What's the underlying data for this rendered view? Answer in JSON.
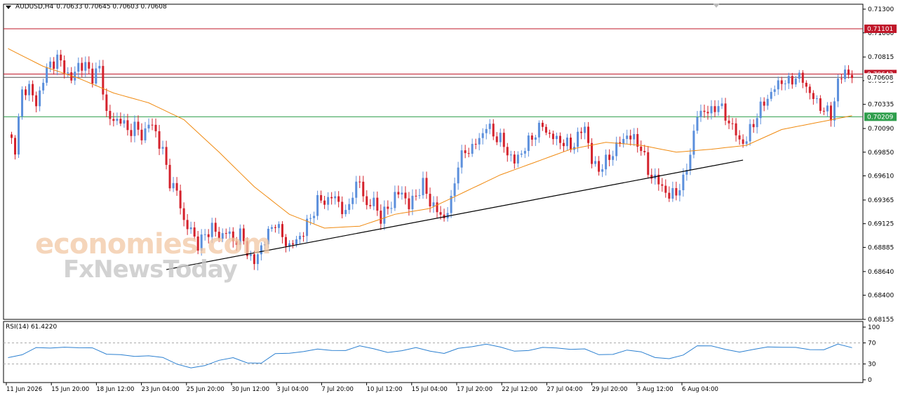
{
  "header": {
    "symbol": "AUDUSD,H4",
    "ohlc": "0.70633 0.70645 0.70603 0.70608"
  },
  "rsi_header": "RSI(14) 61.4220",
  "watermark": {
    "line1": "economies.com",
    "line2": "FxNewsToday"
  },
  "colors": {
    "bull": "#5b8fdc",
    "bear": "#d4222c",
    "ma": "#f08a10",
    "resistance": "#c0182a",
    "support": "#2e9e4c",
    "trendline": "#000000",
    "rsi": "#2a7fd0"
  },
  "chart_data": [
    {
      "type": "candlestick",
      "title": "AUDUSD,H4",
      "x_ticks": [
        "11 Jun 2026",
        "15 Jun 20:00",
        "18 Jun 12:00",
        "23 Jun 04:00",
        "25 Jun 20:00",
        "30 Jun 12:00",
        "3 Jul 04:00",
        "7 Jul 20:00",
        "10 Jul 12:00",
        "15 Jul 04:00",
        "17 Jul 20:00",
        "22 Jul 12:00",
        "27 Jul 04:00",
        "29 Jul 20:00",
        "3 Aug 12:00",
        "6 Aug 04:00"
      ],
      "y_ticks": [
        0.713,
        0.7106,
        0.70815,
        0.70575,
        0.70335,
        0.7009,
        0.6985,
        0.6961,
        0.69365,
        0.69125,
        0.68885,
        0.6864,
        0.684,
        0.68155
      ],
      "ylim": [
        0.68155,
        0.7135
      ],
      "price_labels": [
        {
          "text": "0.71101",
          "value": 0.71101,
          "role": "resistance"
        },
        {
          "text": "0.70642",
          "value": 0.70642,
          "role": "current"
        },
        {
          "text": "0.70608",
          "value": 0.70608,
          "role": "current-close"
        },
        {
          "text": "0.70209",
          "value": 0.70209,
          "role": "support"
        }
      ],
      "horizontal_lines": [
        {
          "value": 0.71101,
          "style": "resistance"
        },
        {
          "value": 0.70642,
          "style": "resistance"
        },
        {
          "value": 0.70608,
          "style": "current"
        },
        {
          "value": 0.70209,
          "style": "support"
        }
      ],
      "trendline": {
        "from": {
          "bar": 45,
          "price": 0.6866
        },
        "to": {
          "bar": 209,
          "price": 0.6977
        }
      },
      "close_path": [
        [
          0,
          0.7003
        ],
        [
          2,
          0.699
        ],
        [
          4,
          0.7045
        ],
        [
          6,
          0.7052
        ],
        [
          8,
          0.7032
        ],
        [
          10,
          0.706
        ],
        [
          12,
          0.7074
        ],
        [
          14,
          0.708
        ],
        [
          16,
          0.707
        ],
        [
          18,
          0.7058
        ],
        [
          20,
          0.7074
        ],
        [
          22,
          0.7072
        ],
        [
          24,
          0.7062
        ],
        [
          26,
          0.707
        ],
        [
          28,
          0.7025
        ],
        [
          30,
          0.7015
        ],
        [
          32,
          0.702
        ],
        [
          34,
          0.7005
        ],
        [
          36,
          0.7012
        ],
        [
          38,
          0.7
        ],
        [
          40,
          0.7015
        ],
        [
          42,
          0.7005
        ],
        [
          44,
          0.6985
        ],
        [
          46,
          0.6955
        ],
        [
          48,
          0.6945
        ],
        [
          50,
          0.6915
        ],
        [
          52,
          0.6905
        ],
        [
          54,
          0.6892
        ],
        [
          56,
          0.69
        ],
        [
          58,
          0.691
        ],
        [
          60,
          0.6898
        ],
        [
          62,
          0.6906
        ],
        [
          64,
          0.6894
        ],
        [
          66,
          0.6902
        ],
        [
          68,
          0.6885
        ],
        [
          70,
          0.6872
        ],
        [
          72,
          0.689
        ],
        [
          74,
          0.6902
        ],
        [
          76,
          0.6915
        ],
        [
          78,
          0.6898
        ],
        [
          80,
          0.689
        ],
        [
          82,
          0.6895
        ],
        [
          84,
          0.6905
        ],
        [
          86,
          0.6918
        ],
        [
          88,
          0.6936
        ],
        [
          90,
          0.6935
        ],
        [
          92,
          0.694
        ],
        [
          94,
          0.6935
        ],
        [
          96,
          0.692
        ],
        [
          98,
          0.6945
        ],
        [
          100,
          0.6955
        ],
        [
          102,
          0.693
        ],
        [
          104,
          0.6935
        ],
        [
          106,
          0.6918
        ],
        [
          108,
          0.6928
        ],
        [
          110,
          0.694
        ],
        [
          112,
          0.6945
        ],
        [
          114,
          0.693
        ],
        [
          116,
          0.6942
        ],
        [
          118,
          0.6952
        ],
        [
          120,
          0.6935
        ],
        [
          122,
          0.6925
        ],
        [
          124,
          0.6918
        ],
        [
          126,
          0.6935
        ],
        [
          128,
          0.6975
        ],
        [
          130,
          0.6985
        ],
        [
          132,
          0.699
        ],
        [
          134,
          0.6998
        ],
        [
          136,
          0.7012
        ],
        [
          138,
          0.7003
        ],
        [
          140,
          0.6998
        ],
        [
          142,
          0.6985
        ],
        [
          144,
          0.6975
        ],
        [
          146,
          0.6985
        ],
        [
          148,
          0.6995
        ],
        [
          150,
          0.7005
        ],
        [
          152,
          0.7012
        ],
        [
          154,
          0.7002
        ],
        [
          156,
          0.6998
        ],
        [
          158,
          0.6995
        ],
        [
          160,
          0.699
        ],
        [
          162,
          0.7
        ],
        [
          164,
          0.7012
        ],
        [
          166,
          0.6975
        ],
        [
          168,
          0.6968
        ],
        [
          170,
          0.6975
        ],
        [
          172,
          0.6985
        ],
        [
          174,
          0.6995
        ],
        [
          176,
          0.7002
        ],
        [
          178,
          0.6998
        ],
        [
          180,
          0.699
        ],
        [
          182,
          0.6965
        ],
        [
          184,
          0.6958
        ],
        [
          186,
          0.695
        ],
        [
          188,
          0.694
        ],
        [
          190,
          0.6945
        ],
        [
          192,
          0.6955
        ],
        [
          194,
          0.6985
        ],
        [
          196,
          0.7022
        ],
        [
          198,
          0.7028
        ],
        [
          200,
          0.7025
        ],
        [
          202,
          0.7035
        ],
        [
          204,
          0.702
        ],
        [
          206,
          0.7012
        ],
        [
          208,
          0.6995
        ],
        [
          210,
          0.6998
        ],
        [
          212,
          0.7015
        ],
        [
          214,
          0.703
        ],
        [
          216,
          0.704
        ],
        [
          218,
          0.705
        ],
        [
          220,
          0.7058
        ],
        [
          222,
          0.7055
        ],
        [
          224,
          0.7062
        ],
        [
          226,
          0.7058
        ],
        [
          228,
          0.7045
        ],
        [
          230,
          0.7035
        ],
        [
          232,
          0.7028
        ],
        [
          234,
          0.7022
        ],
        [
          236,
          0.7055
        ],
        [
          238,
          0.7068
        ],
        [
          240,
          0.7061
        ]
      ],
      "ma_path": [
        [
          0,
          0.709
        ],
        [
          10,
          0.7072
        ],
        [
          20,
          0.706
        ],
        [
          30,
          0.7045
        ],
        [
          40,
          0.7035
        ],
        [
          50,
          0.7018
        ],
        [
          60,
          0.6985
        ],
        [
          70,
          0.695
        ],
        [
          80,
          0.6922
        ],
        [
          90,
          0.6908
        ],
        [
          100,
          0.691
        ],
        [
          110,
          0.6922
        ],
        [
          120,
          0.6928
        ],
        [
          130,
          0.6945
        ],
        [
          140,
          0.6962
        ],
        [
          150,
          0.6975
        ],
        [
          160,
          0.6988
        ],
        [
          170,
          0.6995
        ],
        [
          180,
          0.6992
        ],
        [
          190,
          0.6985
        ],
        [
          200,
          0.6988
        ],
        [
          210,
          0.6992
        ],
        [
          220,
          0.7008
        ],
        [
          230,
          0.7015
        ],
        [
          240,
          0.7022
        ]
      ]
    },
    {
      "type": "line",
      "title": "RSI(14) 61.4220",
      "y_ticks": [
        100,
        70,
        30,
        0
      ],
      "levels": [
        70,
        30
      ],
      "ylim": [
        0,
        100
      ],
      "x_range": [
        0,
        240
      ],
      "points": [
        [
          0,
          42
        ],
        [
          4,
          45
        ],
        [
          8,
          60
        ],
        [
          12,
          62
        ],
        [
          16,
          64
        ],
        [
          20,
          60
        ],
        [
          24,
          58
        ],
        [
          28,
          48
        ],
        [
          32,
          50
        ],
        [
          36,
          46
        ],
        [
          40,
          44
        ],
        [
          44,
          40
        ],
        [
          48,
          30
        ],
        [
          52,
          25
        ],
        [
          56,
          28
        ],
        [
          60,
          35
        ],
        [
          64,
          40
        ],
        [
          68,
          33
        ],
        [
          72,
          34
        ],
        [
          76,
          50
        ],
        [
          80,
          48
        ],
        [
          84,
          52
        ],
        [
          88,
          60
        ],
        [
          92,
          58
        ],
        [
          96,
          55
        ],
        [
          100,
          62
        ],
        [
          104,
          58
        ],
        [
          108,
          54
        ],
        [
          112,
          57
        ],
        [
          116,
          60
        ],
        [
          120,
          52
        ],
        [
          124,
          50
        ],
        [
          128,
          62
        ],
        [
          132,
          64
        ],
        [
          136,
          66
        ],
        [
          140,
          60
        ],
        [
          144,
          55
        ],
        [
          148,
          58
        ],
        [
          152,
          62
        ],
        [
          156,
          58
        ],
        [
          160,
          56
        ],
        [
          164,
          60
        ],
        [
          168,
          50
        ],
        [
          172,
          48
        ],
        [
          176,
          54
        ],
        [
          180,
          52
        ],
        [
          184,
          44
        ],
        [
          188,
          42
        ],
        [
          192,
          46
        ],
        [
          196,
          62
        ],
        [
          200,
          64
        ],
        [
          204,
          60
        ],
        [
          208,
          54
        ],
        [
          212,
          56
        ],
        [
          216,
          60
        ],
        [
          220,
          62
        ],
        [
          224,
          64
        ],
        [
          228,
          58
        ],
        [
          232,
          55
        ],
        [
          236,
          66
        ],
        [
          240,
          62
        ]
      ]
    }
  ]
}
